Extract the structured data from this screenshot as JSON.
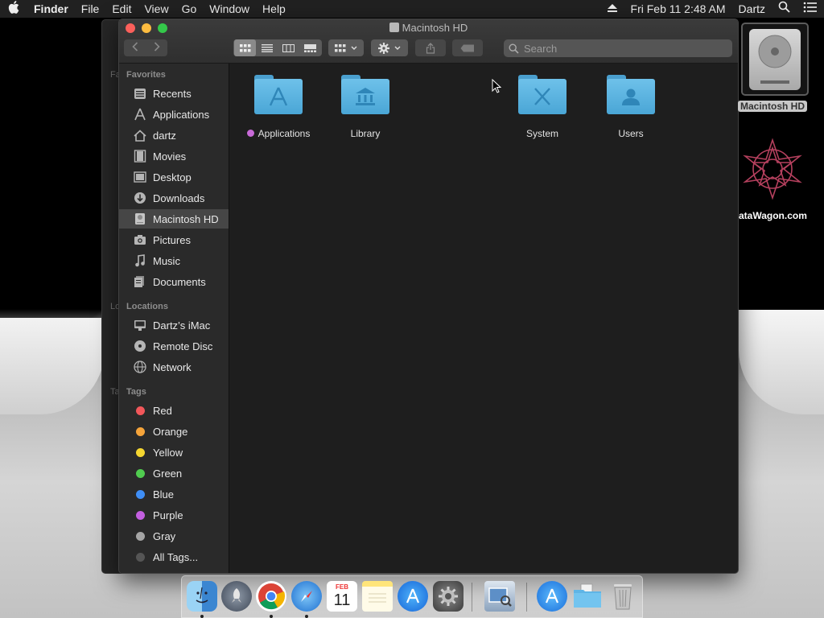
{
  "menubar": {
    "apple": "",
    "app": "Finder",
    "menus": [
      "File",
      "Edit",
      "View",
      "Go",
      "Window",
      "Help"
    ],
    "clock": "Fri Feb 11  2:48 AM",
    "user": "Dartz"
  },
  "background_window": {
    "fragments": [
      "Fa",
      "Lo",
      "Ta"
    ]
  },
  "window": {
    "title": "Macintosh HD",
    "search_placeholder": "Search"
  },
  "sidebar": {
    "favorites_header": "Favorites",
    "favorites": [
      {
        "label": "Recents",
        "icon": "recents-icon"
      },
      {
        "label": "Applications",
        "icon": "applications-icon"
      },
      {
        "label": "dartz",
        "icon": "home-icon"
      },
      {
        "label": "Movies",
        "icon": "movies-icon"
      },
      {
        "label": "Desktop",
        "icon": "desktop-icon"
      },
      {
        "label": "Downloads",
        "icon": "downloads-icon"
      },
      {
        "label": "Macintosh HD",
        "icon": "hard-disk-icon",
        "selected": true
      },
      {
        "label": "Pictures",
        "icon": "pictures-icon"
      },
      {
        "label": "Music",
        "icon": "music-icon"
      },
      {
        "label": "Documents",
        "icon": "documents-icon"
      }
    ],
    "locations_header": "Locations",
    "locations": [
      {
        "label": "Dartz’s iMac",
        "icon": "imac-icon"
      },
      {
        "label": "Remote Disc",
        "icon": "remote-disc-icon"
      },
      {
        "label": "Network",
        "icon": "network-icon"
      }
    ],
    "tags_header": "Tags",
    "tags": [
      {
        "label": "Red",
        "color": "#f2575a"
      },
      {
        "label": "Orange",
        "color": "#f5a43a"
      },
      {
        "label": "Yellow",
        "color": "#f5d630"
      },
      {
        "label": "Green",
        "color": "#50cc4f"
      },
      {
        "label": "Blue",
        "color": "#3f8ef5"
      },
      {
        "label": "Purple",
        "color": "#c35fe0"
      },
      {
        "label": "Gray",
        "color": "#a5a5a5"
      },
      {
        "label": "All Tags...",
        "color": "#555555"
      }
    ]
  },
  "content": {
    "items": [
      {
        "name": "Applications",
        "glyph": "A",
        "tag_color": "#c86ad8"
      },
      {
        "name": "Library",
        "glyph": "🏛"
      },
      {
        "name": "System",
        "glyph": "X"
      },
      {
        "name": "Users",
        "glyph": "👤"
      }
    ]
  },
  "desktop": {
    "disk_label": "Macintosh HD",
    "logo_label": "ataWagon.com"
  },
  "dock": {
    "apps": [
      "Finder",
      "Launchpad",
      "Chrome",
      "Safari",
      "Calendar",
      "Notes",
      "App Store",
      "System Preferences",
      "Preview",
      "Applications",
      "Documents",
      "Trash"
    ],
    "calendar_month": "FEB",
    "calendar_day": "11"
  }
}
